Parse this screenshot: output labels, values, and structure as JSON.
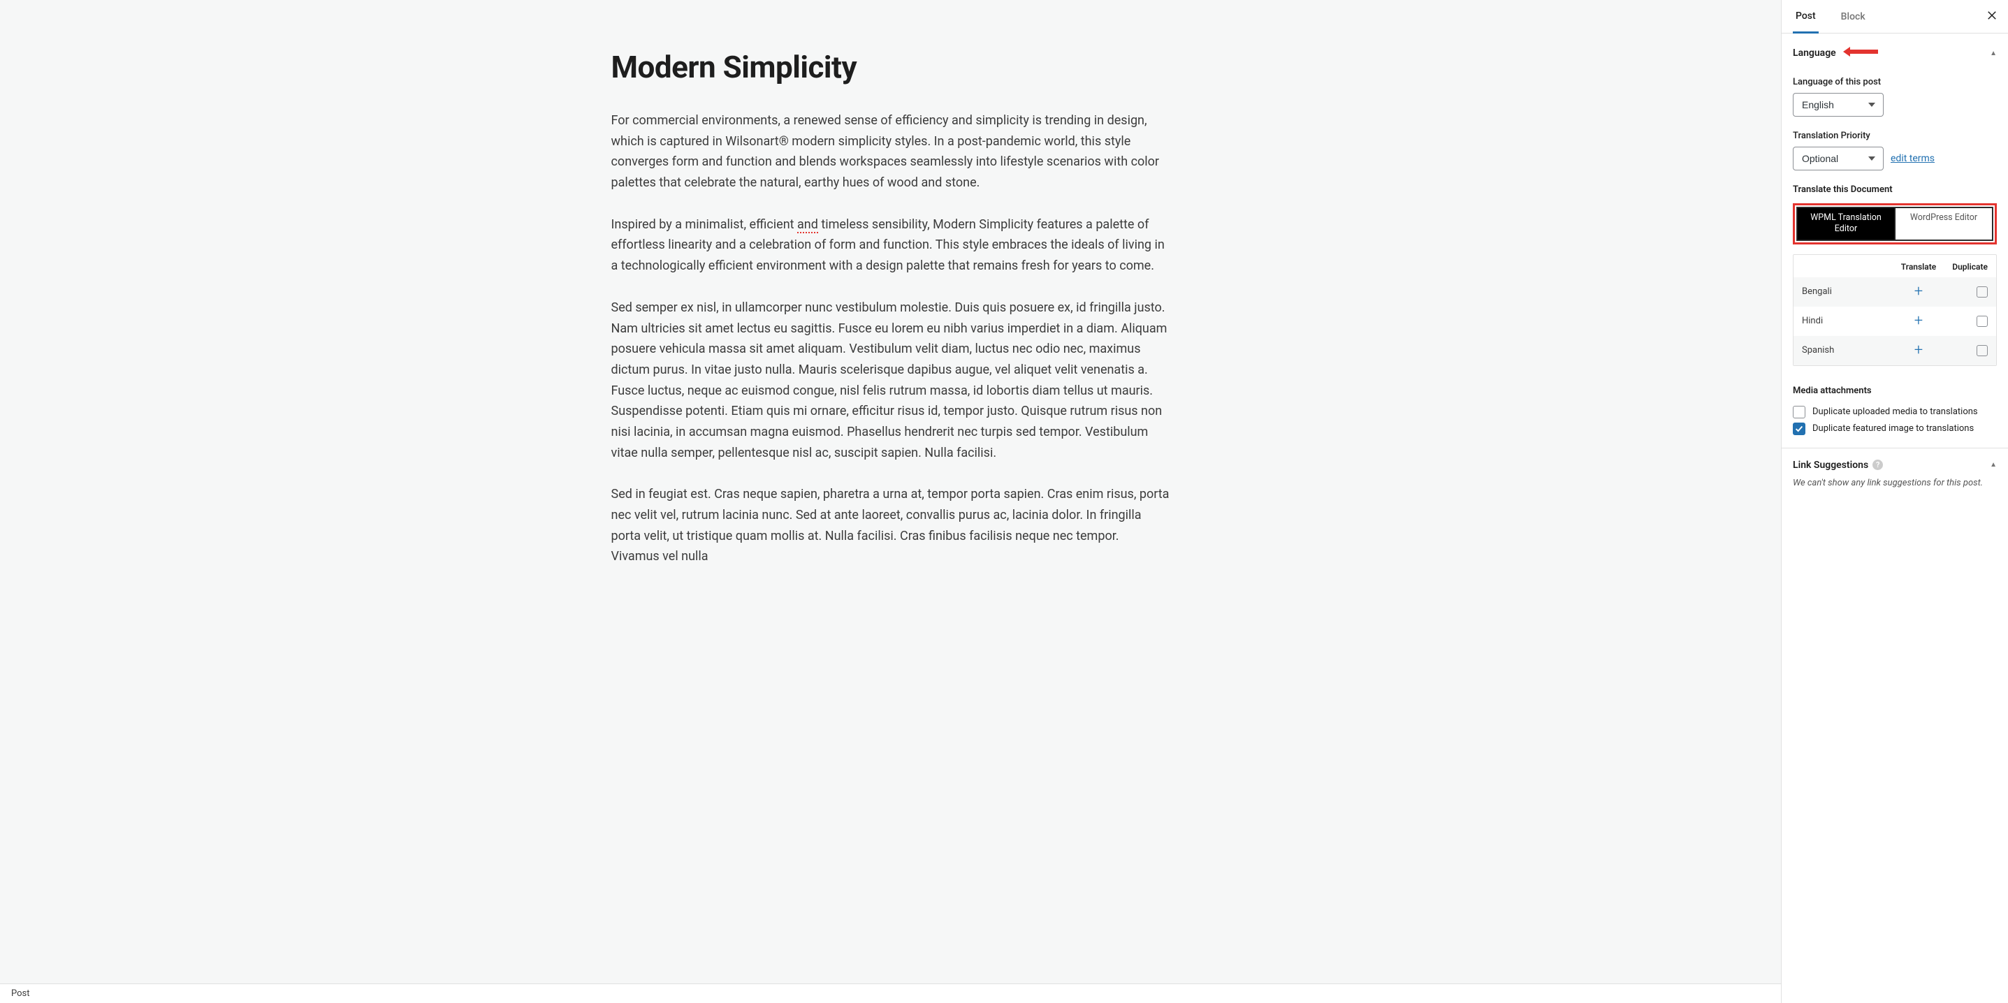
{
  "editor": {
    "title": "Modern Simplicity",
    "paragraphs": [
      "For commercial environments, a renewed sense of efficiency and simplicity is trending in design, which is captured in Wilsonart® modern simplicity styles. In a post-pandemic world, this style converges form and function and blends workspaces seamlessly into lifestyle scenarios with color palettes that celebrate the natural, earthy hues of wood and stone.",
      "Inspired by a minimalist, efficient and timeless sensibility, Modern Simplicity features a palette of effortless linearity and a celebration of form and function. This style embraces the ideals of living in a technologically efficient environment with a design palette that remains fresh for years to come.",
      "Sed semper ex nisl, in ullamcorper nunc vestibulum molestie. Duis quis posuere ex, id fringilla justo. Nam ultricies sit amet lectus eu sagittis. Fusce eu lorem eu nibh varius imperdiet in a diam. Aliquam posuere vehicula massa sit amet aliquam. Vestibulum velit diam, luctus nec odio nec, maximus dictum purus. In vitae justo nulla. Mauris scelerisque dapibus augue, vel aliquet velit venenatis a. Fusce luctus, neque ac euismod congue, nisl felis rutrum massa, id lobortis diam tellus ut mauris. Suspendisse potenti. Etiam quis mi ornare, efficitur risus id, tempor justo. Quisque rutrum risus non nisi lacinia, in accumsan magna euismod. Phasellus hendrerit nec turpis sed tempor. Vestibulum vitae nulla semper, pellentesque nisl ac, suscipit sapien. Nulla facilisi.",
      "Sed in feugiat est. Cras neque sapien, pharetra a urna at, tempor porta sapien. Cras enim risus, porta nec velit vel, rutrum lacinia nunc. Sed at ante laoreet, convallis purus ac, lacinia dolor. In fringilla porta velit, ut tristique quam mollis at. Nulla facilisi. Cras finibus facilisis neque nec tempor. Vivamus vel nulla"
    ]
  },
  "sidebar": {
    "tabs": {
      "post": "Post",
      "block": "Block"
    },
    "language_panel": {
      "title": "Language",
      "lang_of_post_label": "Language of this post",
      "lang_of_post_value": "English",
      "priority_label": "Translation Priority",
      "priority_value": "Optional",
      "edit_terms": "edit terms",
      "translate_doc_label": "Translate this Document",
      "editor_toggle": {
        "wpml": "WPML Translation Editor",
        "wp": "WordPress Editor"
      },
      "table_headers": {
        "translate": "Translate",
        "duplicate": "Duplicate"
      },
      "languages": [
        {
          "name": "Bengali"
        },
        {
          "name": "Hindi"
        },
        {
          "name": "Spanish"
        }
      ],
      "media_title": "Media attachments",
      "media_options": {
        "uploaded": "Duplicate uploaded media to translations",
        "featured": "Duplicate featured image to translations"
      }
    },
    "link_suggestions": {
      "title": "Link Suggestions",
      "text": "We can't show any link suggestions for this post."
    }
  },
  "footer": {
    "label": "Post"
  }
}
